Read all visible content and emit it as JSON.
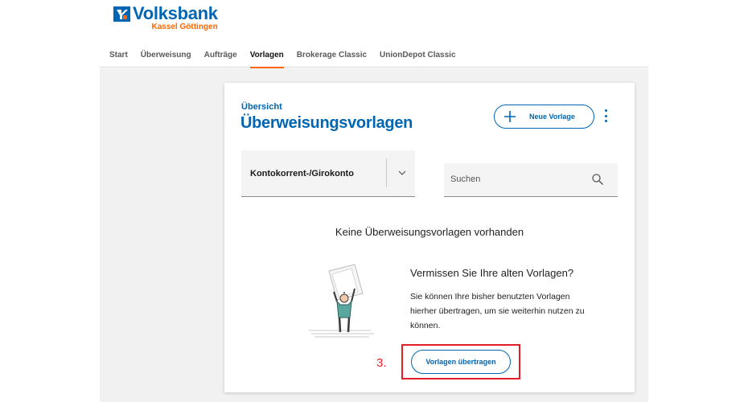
{
  "brand": {
    "name": "Volksbank",
    "sub": "Kassel Göttingen",
    "primary_color": "#0066b3",
    "accent_color": "#ff6600"
  },
  "nav": {
    "items": [
      {
        "label": "Start",
        "active": false
      },
      {
        "label": "Überweisung",
        "active": false
      },
      {
        "label": "Aufträge",
        "active": false
      },
      {
        "label": "Vorlagen",
        "active": true
      },
      {
        "label": "Brokerage Classic",
        "active": false
      },
      {
        "label": "UnionDepot Classic",
        "active": false
      }
    ]
  },
  "page": {
    "subtitle": "Übersicht",
    "title": "Überweisungsvorlagen",
    "new_button": "Neue Vorlage",
    "more_icon": "kebab-icon"
  },
  "filters": {
    "account": "Kontokorrent-/Girokonto",
    "search_placeholder": "Suchen"
  },
  "empty_state": {
    "message": "Keine Überweisungsvorlagen vorhanden",
    "missing_title": "Vermissen Sie Ihre alten Vorlagen?",
    "missing_text": "Sie können Ihre bisher benutzten Vorlagen hierher übertragen, um sie weiterhin nutzen zu können.",
    "transfer_button": "Vorlagen übertragen"
  },
  "annotation": {
    "step": "3.",
    "color": "#e41e26"
  }
}
